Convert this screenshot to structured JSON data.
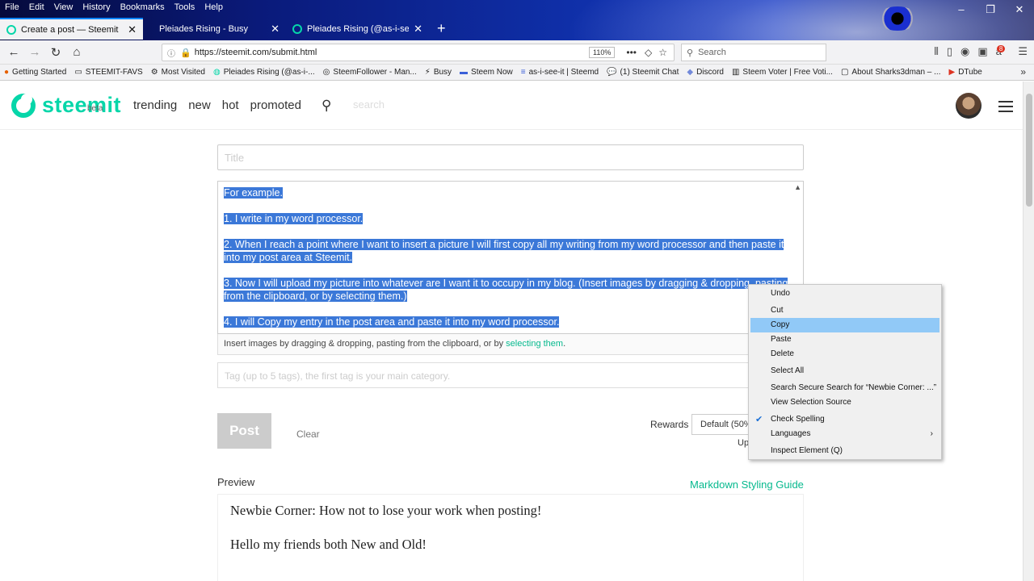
{
  "menubar": [
    "File",
    "Edit",
    "View",
    "History",
    "Bookmarks",
    "Tools",
    "Help"
  ],
  "tabs": [
    {
      "title": "Create a post — Steemit",
      "active": true
    },
    {
      "title": "Pleiades Rising - Busy",
      "active": false
    },
    {
      "title": "Pleiades Rising (@as-i-see-it) …",
      "active": false
    }
  ],
  "nav": {
    "url": "https://steemit.com/submit.html",
    "zoom": "110%",
    "search_placeholder": "Search"
  },
  "bookmarks": [
    {
      "label": "Getting Started",
      "icon": "firefox-icon"
    },
    {
      "label": "STEEMIT-FAVS",
      "icon": "folder-icon"
    },
    {
      "label": "Most Visited",
      "icon": "gear-icon"
    },
    {
      "label": "Pleiades Rising (@as-i-...",
      "icon": "steemit-icon"
    },
    {
      "label": "SteemFollower - Man...",
      "icon": "steemfollower-icon"
    },
    {
      "label": "Busy",
      "icon": "busy-icon"
    },
    {
      "label": "Steem Now",
      "icon": "steemnow-icon"
    },
    {
      "label": "as-i-see-it | Steemd",
      "icon": "steemd-icon"
    },
    {
      "label": "(1) Steemit Chat",
      "icon": "chat-icon"
    },
    {
      "label": "Discord",
      "icon": "discord-icon"
    },
    {
      "label": "Steem Voter | Free Voti...",
      "icon": "voter-icon"
    },
    {
      "label": "About Sharks3dman – ...",
      "icon": "page-icon"
    },
    {
      "label": "DTube",
      "icon": "dtube-icon"
    }
  ],
  "site": {
    "logo": "steemit",
    "beta": "beta",
    "nav": [
      "trending",
      "new",
      "hot",
      "promoted"
    ],
    "search_placeholder": "search"
  },
  "editor": {
    "title_placeholder": "Title",
    "paragraphs": [
      "For example.",
      "1. I write in my word processor.",
      "2. When I reach a point where I want to insert a picture I will first copy all my writing from my word processor and then paste it into my post area at Steemit.",
      "3. Now I will upload my picture into whatever are I want it to occupy in my blog. (Insert images by dragging & dropping, pasting from the clipboard, or by selecting them.)",
      "4. I will Copy my entry in the post area and paste it into my word processor."
    ],
    "hint_prefix": "Insert images by dragging & dropping, pasting from the clipboard, or by ",
    "hint_link": "selecting them",
    "hint_suffix": ".",
    "tags_placeholder": "Tag (up to 5 tags), the first tag is your main category."
  },
  "actions": {
    "post": "Post",
    "clear": "Clear",
    "rewards_label": "Rewards",
    "rewards_value": "Default (50% / 50%)",
    "upvote_label": "Up"
  },
  "preview": {
    "label": "Preview",
    "guide_link": "Markdown Styling Guide",
    "heading": "Newbie Corner: How not to lose your work when posting!",
    "line1": "Hello my friends both New and Old!"
  },
  "context_menu": [
    {
      "label": "Undo",
      "type": "item"
    },
    {
      "type": "sep"
    },
    {
      "label": "Cut",
      "type": "item"
    },
    {
      "label": "Copy",
      "type": "item",
      "highlighted": true
    },
    {
      "label": "Paste",
      "type": "item"
    },
    {
      "label": "Delete",
      "type": "item"
    },
    {
      "type": "sep"
    },
    {
      "label": "Select All",
      "type": "item"
    },
    {
      "type": "sep"
    },
    {
      "label": "Search Secure Search for “Newbie Corner: ...”",
      "type": "item"
    },
    {
      "label": "View Selection Source",
      "type": "item"
    },
    {
      "type": "sep"
    },
    {
      "label": "Check Spelling",
      "type": "item",
      "checked": true
    },
    {
      "label": "Languages",
      "type": "item",
      "submenu": true
    },
    {
      "type": "sep"
    },
    {
      "label": "Inspect Element (Q)",
      "type": "item"
    }
  ]
}
